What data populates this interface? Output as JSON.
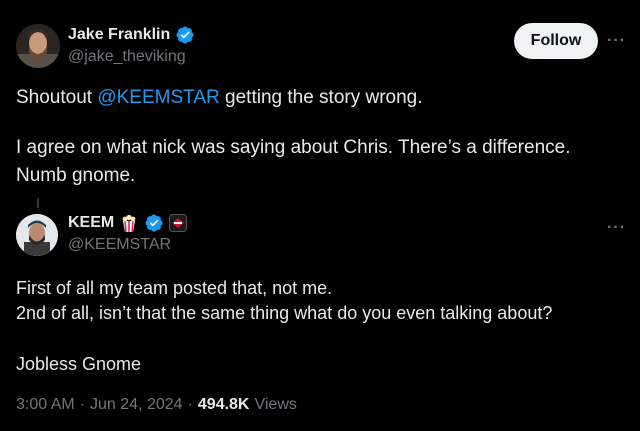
{
  "main_tweet": {
    "display_name": "Jake Franklin",
    "handle": "@jake_theviking",
    "follow_label": "Follow",
    "more_label": "···",
    "text_prefix": "Shoutout ",
    "mention": "@KEEMSTAR",
    "text_suffix": " getting the story wrong.",
    "paragraph2": "I agree on what nick was saying about Chris. There’s a difference. Numb gnome."
  },
  "quoted_tweet": {
    "display_name": "KEEM",
    "handle": "@KEEMSTAR",
    "more_label": "···",
    "line1": "First of all my team posted that, not me.",
    "line2": "2nd of all, isn’t that the same thing what do you even talking about?",
    "line3": "Jobless Gnome"
  },
  "meta": {
    "time": "3:00 AM",
    "separator1": "·",
    "date": "Jun 24, 2024",
    "separator2": "·",
    "views_count": "494.8K",
    "views_label": "Views"
  },
  "colors": {
    "background": "#000000",
    "text": "#e7e9ea",
    "muted": "#71767b",
    "accent": "#1d9bf0"
  },
  "icons": {
    "verified": "verified-badge-icon",
    "popcorn": "popcorn-emoji-icon",
    "affiliate": "affiliate-badge-icon"
  }
}
